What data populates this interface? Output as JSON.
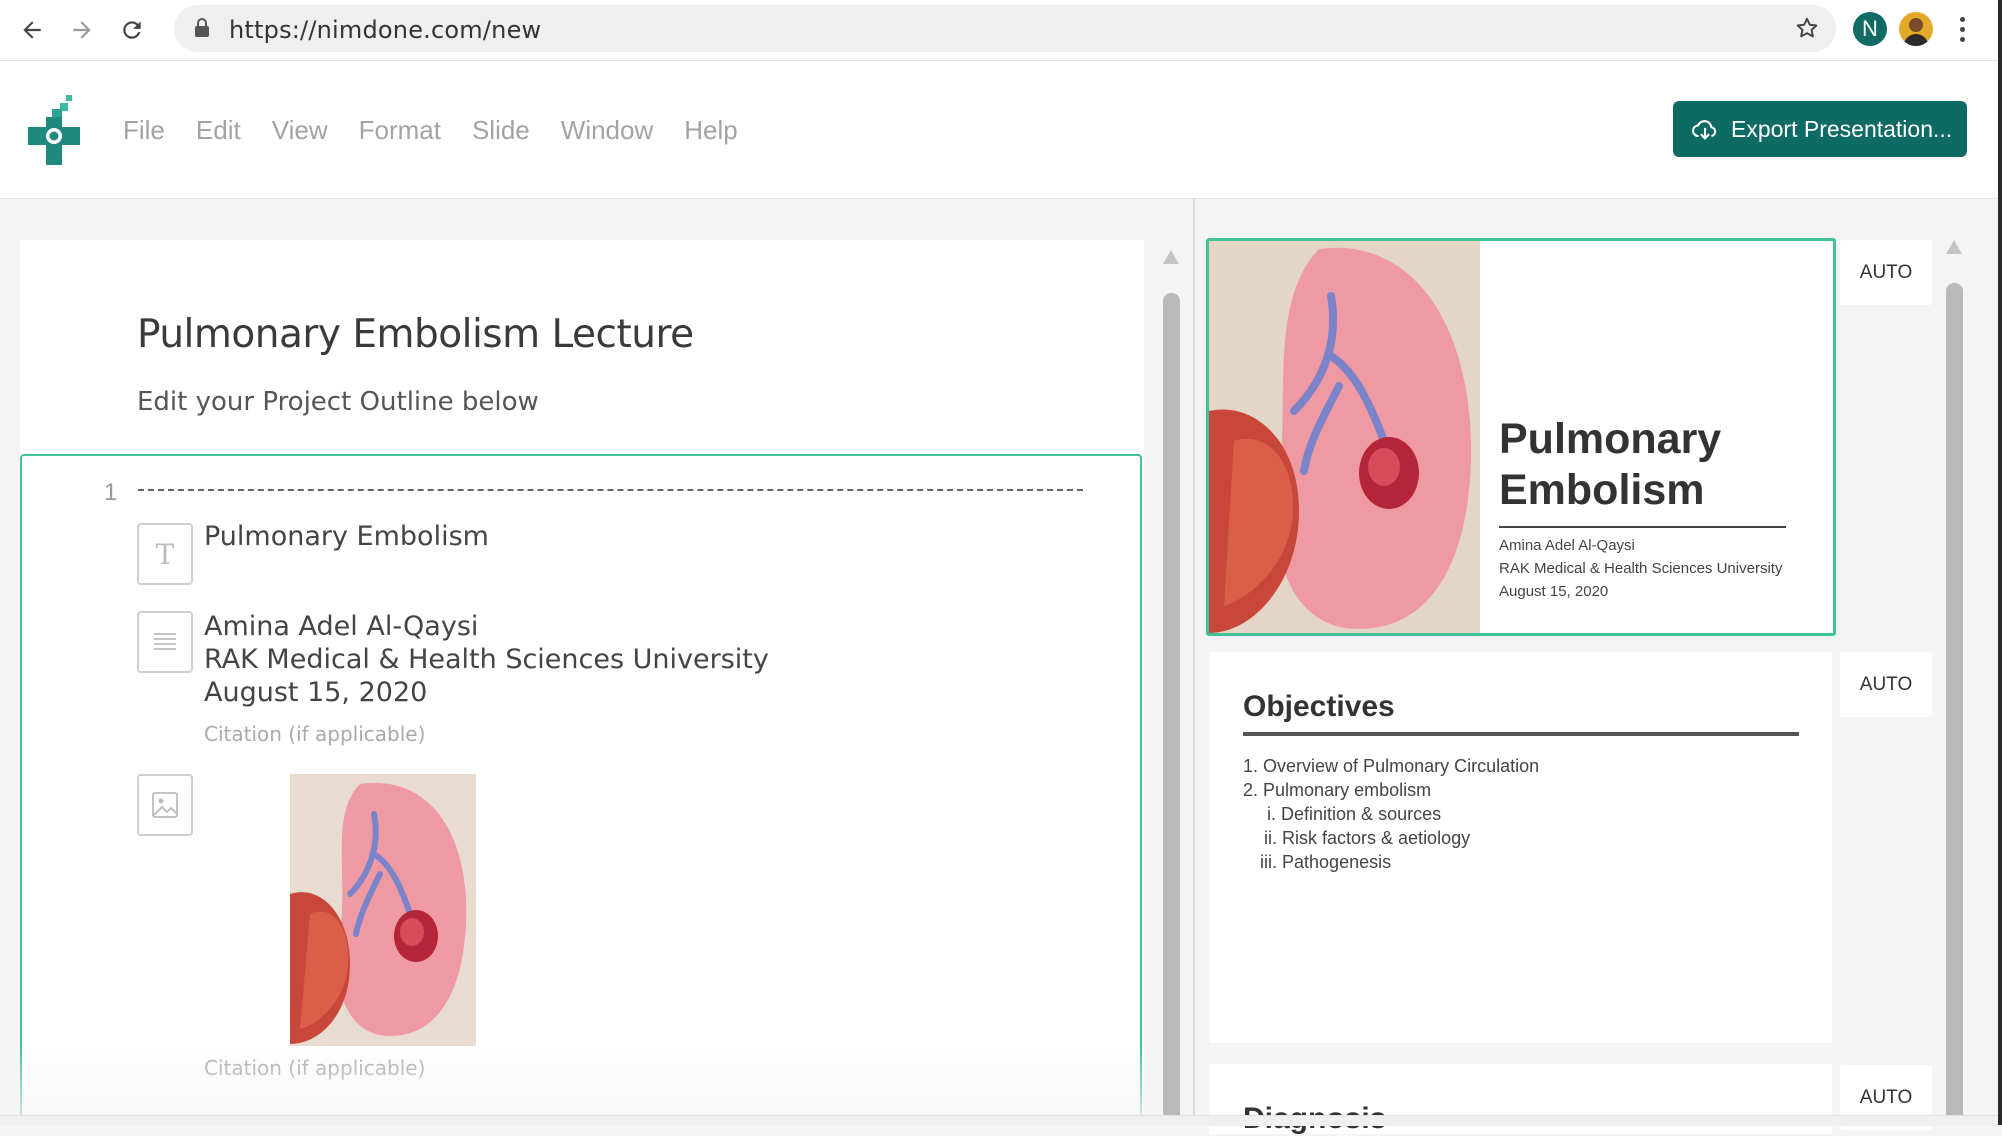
{
  "browser": {
    "url": "https://nimdone.com/new",
    "profile_initial": "N"
  },
  "app": {
    "menu": [
      "File",
      "Edit",
      "View",
      "Format",
      "Slide",
      "Window",
      "Help"
    ],
    "export_label": "Export Presentation...",
    "accent_color": "#0e6b63",
    "selection_color": "#42c29a"
  },
  "outline": {
    "project_title": "Pulmonary Embolism Lecture",
    "project_subtitle": "Edit your Project Outline below",
    "slide": {
      "number": "1",
      "title": "Pulmonary Embolism",
      "body_lines": [
        "Amina Adel Al-Qaysi",
        "RAK Medical & Health Sciences University",
        "August 15, 2020"
      ],
      "citation_placeholder_1": "Citation (if applicable)",
      "citation_placeholder_2": "Citation (if applicable)"
    }
  },
  "preview": {
    "auto_label": "AUTO",
    "slide1": {
      "title": "Pulmonary Embolism",
      "lines": [
        "Amina Adel Al-Qaysi",
        "RAK Medical & Health Sciences University",
        "August 15, 2020"
      ]
    },
    "slide2": {
      "title": "Objectives",
      "items": [
        {
          "marker": "1.",
          "text": "Overview of Pulmonary Circulation"
        },
        {
          "marker": "2.",
          "text": "Pulmonary embolism"
        },
        {
          "marker": "i.",
          "text": "Definition & sources"
        },
        {
          "marker": "ii.",
          "text": "Risk factors & aetiology"
        },
        {
          "marker": "iii.",
          "text": "Pathogenesis"
        }
      ]
    },
    "slide3": {
      "title": "Diagnosis"
    }
  }
}
